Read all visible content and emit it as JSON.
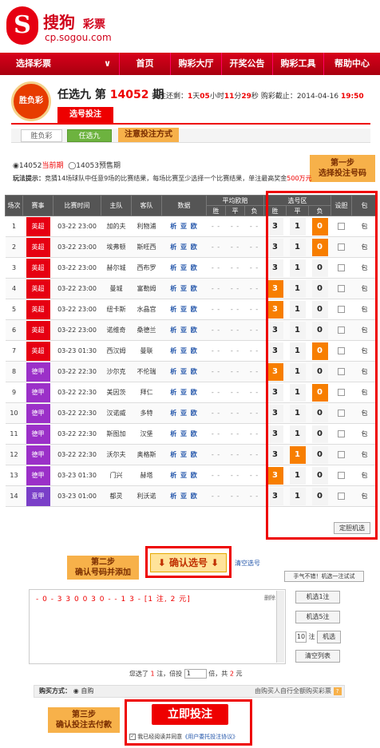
{
  "brand": {
    "logo_glyph": "S",
    "name": "搜狗",
    "sub": "彩票",
    "domain": "cp.sogou.com"
  },
  "nav": {
    "select_label": "选择彩票",
    "chevron": "∨",
    "items": [
      "首页",
      "购彩大厅",
      "开奖公告",
      "购彩工具",
      "帮助中心"
    ]
  },
  "game": {
    "badge": "胜负彩",
    "title_prefix": "任选九 第",
    "issue": "14052",
    "title_suffix": "期",
    "deadline_prefix": "投注还剩：",
    "days": "1",
    "hours": "05",
    "mins": "11",
    "secs": "29",
    "u_day": "天",
    "u_hour": "小时",
    "u_min": "分",
    "u_sec": "秒",
    "deadline_label": "购彩截止：2014-04-16",
    "deadline_time": "19:50",
    "bet_tab": "选号投注"
  },
  "subtabs": [
    "胜负彩",
    "任选九"
  ],
  "callouts": {
    "c1": "注意投注方式",
    "c2": [
      "第一步",
      "选择投注号码"
    ],
    "c3": [
      "第二步",
      "确认号码并添加"
    ],
    "c4": [
      "第三步",
      "确认投注去付款"
    ]
  },
  "phase": {
    "current": "◉14052",
    "current_label": "当前期",
    "pre": "◯14053",
    "pre_label": "预售期"
  },
  "rules": {
    "label": "玩法提示：",
    "text": "竞猜14场球队中任意9场的比赛结果，每场比赛至少选择一个比赛结果，单注最高奖金",
    "prize": "500万元"
  },
  "table": {
    "headers": [
      "场次",
      "赛事",
      "比赛时间",
      "主队",
      "客队",
      "数据",
      "平均欧赔",
      "选号区",
      "设胆",
      "包"
    ],
    "sub_headers": [
      "胜",
      "平",
      "负",
      "胜",
      "平",
      "负"
    ],
    "odds": "- -",
    "links": "析 亚 欧",
    "opt_labels": [
      "3",
      "1",
      "0"
    ],
    "bao": "包",
    "rows": [
      {
        "no": "1",
        "league": "英超",
        "color": "#e60012",
        "time": "03-22 23:00",
        "home": "加的夫",
        "away": "利物浦",
        "sel": [
          0,
          0,
          1
        ]
      },
      {
        "no": "2",
        "league": "英超",
        "color": "#e60012",
        "time": "03-22 23:00",
        "home": "埃弗顿",
        "away": "斯旺西",
        "sel": [
          0,
          0,
          1
        ]
      },
      {
        "no": "3",
        "league": "英超",
        "color": "#e60012",
        "time": "03-22 23:00",
        "home": "赫尔城",
        "away": "西布罗",
        "sel": [
          0,
          0,
          0
        ]
      },
      {
        "no": "4",
        "league": "英超",
        "color": "#e60012",
        "time": "03-22 23:00",
        "home": "曼城",
        "away": "富勒姆",
        "sel": [
          1,
          0,
          0
        ]
      },
      {
        "no": "5",
        "league": "英超",
        "color": "#e60012",
        "time": "03-22 23:00",
        "home": "纽卡斯",
        "away": "水晶宫",
        "sel": [
          1,
          0,
          0
        ]
      },
      {
        "no": "6",
        "league": "英超",
        "color": "#e60012",
        "time": "03-22 23:00",
        "home": "诺维奇",
        "away": "桑德兰",
        "sel": [
          0,
          0,
          0
        ]
      },
      {
        "no": "7",
        "league": "英超",
        "color": "#e60012",
        "time": "03-23 01:30",
        "home": "西汉姆",
        "away": "曼联",
        "sel": [
          0,
          0,
          1
        ]
      },
      {
        "no": "8",
        "league": "德甲",
        "color": "#9b30c8",
        "time": "03-22 22:30",
        "home": "沙尔克",
        "away": "不伦瑞",
        "sel": [
          1,
          0,
          0
        ]
      },
      {
        "no": "9",
        "league": "德甲",
        "color": "#9b30c8",
        "time": "03-22 22:30",
        "home": "美因茨",
        "away": "拜仁",
        "sel": [
          0,
          0,
          1
        ]
      },
      {
        "no": "10",
        "league": "德甲",
        "color": "#9b30c8",
        "time": "03-22 22:30",
        "home": "汉诺威",
        "away": "多特",
        "sel": [
          0,
          0,
          0
        ]
      },
      {
        "no": "11",
        "league": "德甲",
        "color": "#9b30c8",
        "time": "03-22 22:30",
        "home": "斯图加",
        "away": "汉堡",
        "sel": [
          0,
          0,
          0
        ]
      },
      {
        "no": "12",
        "league": "德甲",
        "color": "#9b30c8",
        "time": "03-22 22:30",
        "home": "沃尔夫",
        "away": "奥格斯",
        "sel": [
          0,
          1,
          0
        ]
      },
      {
        "no": "13",
        "league": "德甲",
        "color": "#9b30c8",
        "time": "03-23 01:30",
        "home": "门兴",
        "away": "赫塔",
        "sel": [
          1,
          0,
          0
        ]
      },
      {
        "no": "14",
        "league": "意甲",
        "color": "#7a3fc8",
        "time": "03-23 01:00",
        "home": "都灵",
        "away": "利沃诺",
        "sel": [
          0,
          0,
          0
        ]
      }
    ],
    "ding": "定胆机选"
  },
  "confirm": {
    "label": "⬇ 确认选号 ⬇",
    "clear": "清空选号"
  },
  "lucky": "手气不错！机选一注试试",
  "selection": {
    "line": "- 0 - 3 3 0 0 3 0 - - 1 3 - [1 注, 2 元]",
    "delete": "删除"
  },
  "side": {
    "rand1": "机选1注",
    "rand5": "机选5注",
    "count": "10",
    "count_unit": "注",
    "rand_n": "机选",
    "clear_list": "清空列表"
  },
  "summary": {
    "prefix": "您选了",
    "bets": "1",
    "mid1": "注，倍投",
    "mult": "1",
    "mid2": "倍，共",
    "total": "2",
    "suffix": "元"
  },
  "pay": {
    "label": "购买方式：",
    "option": "◉ 自购",
    "right": "由购买人自行全额购买彩票",
    "q": "?"
  },
  "submit": {
    "label": "立即投注",
    "agree_prefix": "我已经阅读并同意",
    "agree_link": "《用户委托投注协议》",
    "check": "✓"
  }
}
